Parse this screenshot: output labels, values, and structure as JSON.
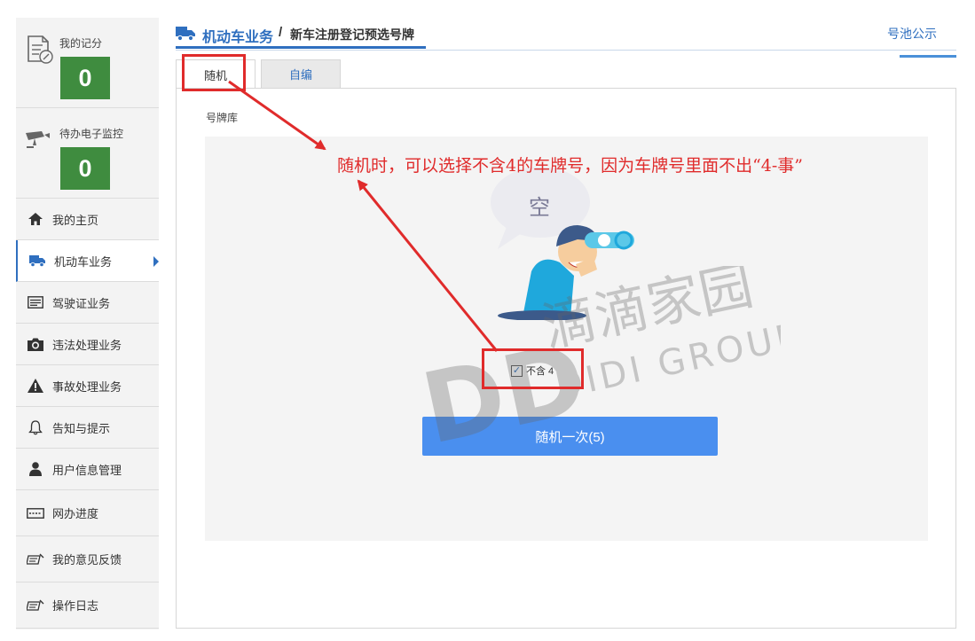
{
  "sidebar": {
    "score_card": {
      "label": "我的记分",
      "value": "0"
    },
    "monitor_card": {
      "label": "待办电子监控",
      "value": "0"
    },
    "items": [
      {
        "label": "我的主页",
        "icon": "home-icon"
      },
      {
        "label": "机动车业务",
        "icon": "truck-icon",
        "active": true
      },
      {
        "label": "驾驶证业务",
        "icon": "license-card-icon"
      },
      {
        "label": "违法处理业务",
        "icon": "camera-icon"
      },
      {
        "label": "事故处理业务",
        "icon": "warning-icon"
      },
      {
        "label": "告知与提示",
        "icon": "bell-icon"
      },
      {
        "label": "用户信息管理",
        "icon": "user-icon"
      },
      {
        "label": "网办进度",
        "icon": "progress-icon"
      },
      {
        "label": "我的意见反馈",
        "icon": "feedback-icon"
      },
      {
        "label": "操作日志",
        "icon": "log-icon"
      }
    ]
  },
  "header": {
    "section": "机动车业务",
    "separator": "/",
    "page": "新车注册登记预选号牌",
    "pool_link": "号池公示"
  },
  "tabs": [
    {
      "label": "随机",
      "active": true
    },
    {
      "label": "自编",
      "active": false
    }
  ],
  "main": {
    "pool_label": "号牌库",
    "empty_text": "空",
    "exclude_four_label": "不含 4",
    "exclude_four_checked": true,
    "random_button_label": "随机一次(5)"
  },
  "annotation": {
    "text": "随机时，可以选择不含4的车牌号，因为车牌号里面不出“4-事”",
    "color": "#e02b2b"
  },
  "watermark": {
    "logo": "DD",
    "name": "滴滴家园",
    "group": "DIDI GROUP"
  },
  "colors": {
    "accent": "#2f6fbf",
    "score_green": "#3f8c3f",
    "button_blue": "#4a8fef",
    "annotation_red": "#e02b2b"
  }
}
